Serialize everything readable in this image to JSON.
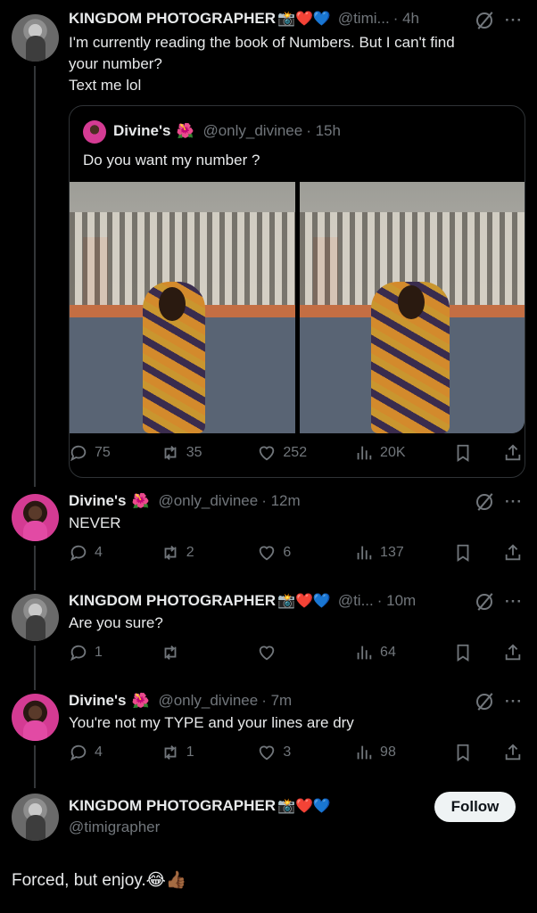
{
  "tweets": [
    {
      "name": "KINGDOM PHOTOGRAPHER",
      "emojis": "📸❤️💙",
      "handle": "@timi...",
      "time": "· 4h",
      "text": "I'm currently reading the book of Numbers. But I can't find\nyour number?\nText me lol",
      "quote": {
        "name": "Divine's",
        "emoji": "🌺",
        "handle": "@only_divinee",
        "time": "· 15h",
        "text": "Do you want my number ?"
      },
      "replies": "75",
      "reposts": "35",
      "likes": "252",
      "views": "20K"
    },
    {
      "name": "Divine's",
      "emojis": "🌺",
      "handle": "@only_divinee",
      "time": "· 12m",
      "text": "NEVER",
      "replies": "4",
      "reposts": "2",
      "likes": "6",
      "views": "137"
    },
    {
      "name": "KINGDOM PHOTOGRAPHER",
      "emojis": "📸❤️💙",
      "handle": "@ti...",
      "time": "· 10m",
      "text": "Are you sure?",
      "replies": "1",
      "reposts": "",
      "likes": "",
      "views": "64"
    },
    {
      "name": "Divine's",
      "emojis": "🌺",
      "handle": "@only_divinee",
      "time": "· 7m",
      "text": "You're not my TYPE  and your lines are dry",
      "replies": "4",
      "reposts": "1",
      "likes": "3",
      "views": "98"
    }
  ],
  "profile": {
    "name": "KINGDOM PHOTOGRAPHER",
    "emojis": "📸❤️💙",
    "handle": "@timigrapher",
    "follow_label": "Follow"
  },
  "caption": "Forced, but enjoy.😂👍🏾",
  "icons": {
    "reply": "reply-icon",
    "repost": "repost-icon",
    "like": "heart-icon",
    "views": "views-icon",
    "bookmark": "bookmark-icon",
    "share": "share-icon",
    "grok": "grok-icon",
    "more": "more-icon"
  },
  "colors": {
    "background": "#000000",
    "text": "#e7e9ea",
    "muted": "#71767b",
    "border": "#2f3336"
  }
}
